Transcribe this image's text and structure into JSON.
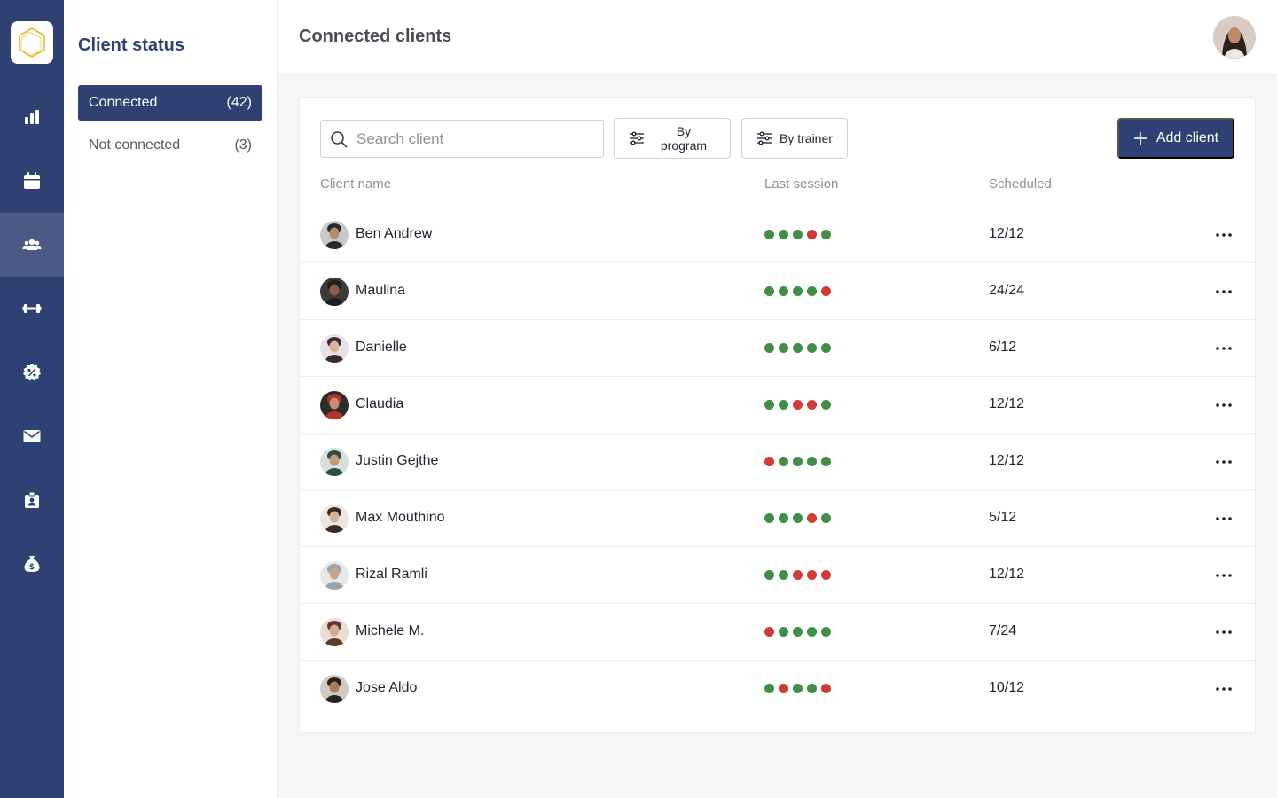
{
  "nav": {
    "items": [
      {
        "icon": "bar-chart-icon",
        "active": false
      },
      {
        "icon": "calendar-icon",
        "active": false
      },
      {
        "icon": "users-icon",
        "active": true
      },
      {
        "icon": "dumbbell-icon",
        "active": false
      },
      {
        "icon": "discount-badge-icon",
        "active": false
      },
      {
        "icon": "mail-icon",
        "active": false
      },
      {
        "icon": "id-badge-icon",
        "active": false
      },
      {
        "icon": "money-bag-icon",
        "active": false
      }
    ]
  },
  "status_panel": {
    "title": "Client status",
    "items": [
      {
        "label": "Connected",
        "count": "(42)",
        "active": true
      },
      {
        "label": "Not connected",
        "count": "(3)",
        "active": false
      }
    ]
  },
  "header": {
    "title": "Connected clients"
  },
  "toolbar": {
    "search_placeholder": "Search client",
    "search_value": "",
    "filter_program_label": "By program",
    "filter_trainer_label": "By trainer",
    "add_label": "Add client"
  },
  "table": {
    "columns": {
      "name": "Client name",
      "last_session": "Last session",
      "scheduled": "Scheduled"
    },
    "rows": [
      {
        "name": "Ben Andrew",
        "sessions": [
          "g",
          "g",
          "g",
          "r",
          "g"
        ],
        "scheduled": "12/12"
      },
      {
        "name": "Maulina",
        "sessions": [
          "g",
          "g",
          "g",
          "g",
          "r"
        ],
        "scheduled": "24/24"
      },
      {
        "name": "Danielle",
        "sessions": [
          "g",
          "g",
          "g",
          "g",
          "g"
        ],
        "scheduled": "6/12"
      },
      {
        "name": "Claudia",
        "sessions": [
          "g",
          "g",
          "r",
          "r",
          "g"
        ],
        "scheduled": "12/12"
      },
      {
        "name": "Justin Gejthe",
        "sessions": [
          "r",
          "g",
          "g",
          "g",
          "g"
        ],
        "scheduled": "12/12"
      },
      {
        "name": "Max Mouthino",
        "sessions": [
          "g",
          "g",
          "g",
          "r",
          "g"
        ],
        "scheduled": "5/12"
      },
      {
        "name": "Rizal Ramli",
        "sessions": [
          "g",
          "g",
          "r",
          "r",
          "r"
        ],
        "scheduled": "12/12"
      },
      {
        "name": "Michele M.",
        "sessions": [
          "r",
          "g",
          "g",
          "g",
          "g"
        ],
        "scheduled": "7/24"
      },
      {
        "name": "Jose Aldo",
        "sessions": [
          "g",
          "r",
          "g",
          "g",
          "r"
        ],
        "scheduled": "10/12"
      }
    ]
  },
  "colors": {
    "brand": "#2f4172",
    "success": "#3f8f46",
    "missed": "#d13a36",
    "logo_accent": "#e8b923"
  }
}
